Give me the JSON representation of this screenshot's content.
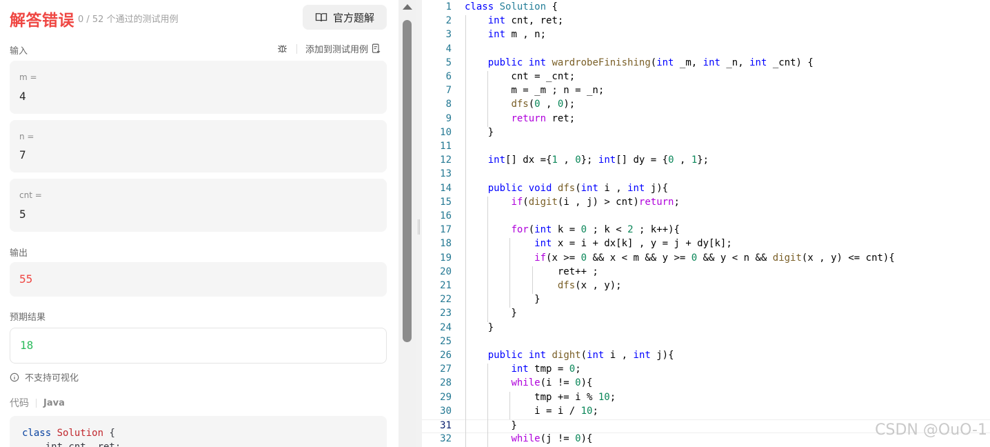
{
  "result": {
    "title": "解答错误",
    "subtitle": "0 / 52 个通过的测试用例",
    "solution_button": "官方题解"
  },
  "input": {
    "label": "输入",
    "add_testcase": "添加到测试用例",
    "params": [
      {
        "name": "m =",
        "value": "4"
      },
      {
        "name": "n =",
        "value": "7"
      },
      {
        "name": "cnt =",
        "value": "5"
      }
    ]
  },
  "output": {
    "label": "输出",
    "value": "55"
  },
  "expected": {
    "label": "预期结果",
    "value": "18"
  },
  "visualization": {
    "text": "不支持可视化"
  },
  "code_section": {
    "label": "代码",
    "language": "Java",
    "preview_line1_kw": "class",
    "preview_line1_name": "Solution",
    "preview_line1_brace": "{",
    "preview_line2": "    int cnt, ret;"
  },
  "editor": {
    "current_line": 31,
    "lines": [
      "class Solution {",
      "    int cnt, ret;",
      "    int m , n;",
      "",
      "    public int wardrobeFinishing(int _m, int _n, int _cnt) {",
      "        cnt = _cnt;",
      "        m = _m ; n = _n;",
      "        dfs(0 , 0);",
      "        return ret;",
      "    }",
      "",
      "    int[] dx ={1 , 0}; int[] dy = {0 , 1};",
      "",
      "    public void dfs(int i , int j){",
      "        if(digit(i , j) > cnt)return;",
      "",
      "        for(int k = 0 ; k < 2 ; k++){",
      "            int x = i + dx[k] , y = j + dy[k];",
      "            if(x >= 0 && x < m && y >= 0 && y < n && digit(x , y) <= cnt){",
      "                ret++ ;",
      "                dfs(x , y);",
      "            }",
      "        }",
      "    }",
      "",
      "    public int dight(int i , int j){",
      "        int tmp = 0;",
      "        while(i != 0){",
      "            tmp += i % 10;",
      "            i = i / 10;",
      "        }",
      "        while(j != 0){"
    ]
  },
  "watermark": "CSDN @OuO-1",
  "colors": {
    "error": "#ef4743",
    "success": "#2cbb5d",
    "keyword": "#0000ff",
    "control": "#af00db",
    "function": "#795e26",
    "number": "#098658",
    "class_name": "#267f99",
    "line_number": "#237893"
  }
}
